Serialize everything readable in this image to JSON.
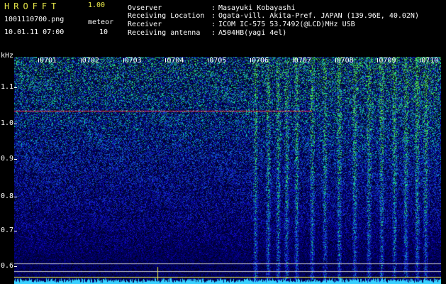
{
  "header": {
    "app_title": "HROFFT",
    "app_version": "1.00",
    "filename": "1001110700.png",
    "datetime": "10.01.11 07:00",
    "meteor_label": "meteor",
    "meteor_count": "10"
  },
  "info": {
    "observer_label": "Ovserver",
    "observer_value": "Masayuki Kobayashi",
    "location_label": "Receiving Location",
    "location_value": "Ogata-vill. Akita-Pref. JAPAN (139.96E, 40.02N)",
    "receiver_label": "Receiver",
    "receiver_value": "ICOM IC-575 53.7492(@LCD)MHz USB",
    "antenna_label": "Receiving antenna",
    "antenna_value": "A504HB(yagi 4el)",
    "separator": ":"
  },
  "axis": {
    "unit": "kHz",
    "y_ticks": [
      "1.1",
      "1.0",
      "0.9",
      "0.8",
      "0.7",
      "0.6"
    ],
    "time_ticks": [
      "0701",
      "0702",
      "0703",
      "0704",
      "0705",
      "0706",
      "0707",
      "0708",
      "0709",
      "0710"
    ]
  },
  "colors": {
    "background": "#000000",
    "signal_low": "#0a1a8c",
    "signal_mid": "#2f7fff",
    "signal_high": "#7cff4a",
    "reference_line": "#ff3b3b",
    "title": "#e8e84a"
  }
}
